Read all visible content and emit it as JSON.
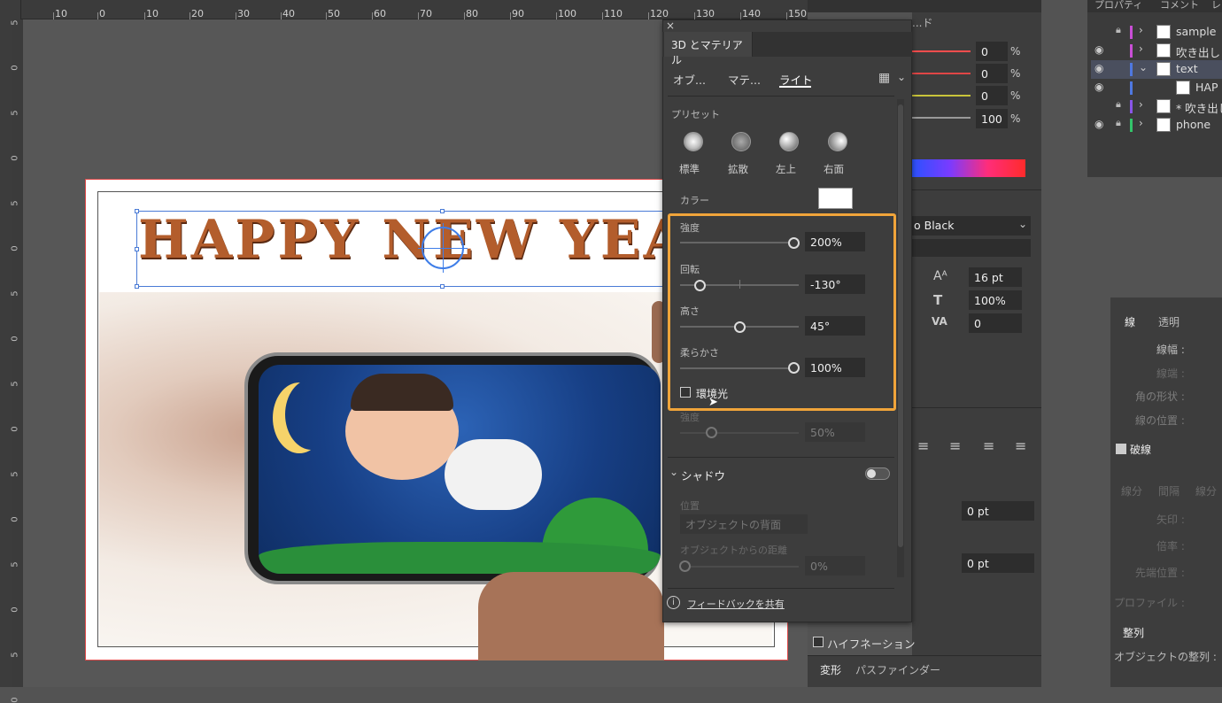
{
  "ruler": {
    "labels": [
      "10",
      "0",
      "10",
      "20",
      "30",
      "40",
      "50",
      "60",
      "70",
      "80",
      "90",
      "100",
      "110",
      "120",
      "130",
      "140",
      "150"
    ]
  },
  "ruler_left": {
    "labels": [
      "5",
      "0",
      "5",
      "0",
      "5",
      "0",
      "5",
      "0",
      "5",
      "0",
      "5",
      "0",
      "5",
      "0",
      "5",
      "0"
    ]
  },
  "artwork": {
    "headline": "HAPPY NEW YEA"
  },
  "panel": {
    "title": "3D とマテリアル",
    "tabs": [
      "オブ...",
      "マテ...",
      "ライト"
    ],
    "active_tab": "ライト",
    "preset_label": "プリセット",
    "presets": [
      "標準",
      "拡散",
      "左上",
      "右面"
    ],
    "color_label": "カラー",
    "color_value": "#ffffff",
    "intensity_label": "強度",
    "intensity_value": "200%",
    "intensity_fraction": 1.0,
    "rotation_label": "回転",
    "rotation_value": "-130°",
    "height_label": "高さ",
    "height_value": "45°",
    "softness_label": "柔らかさ",
    "softness_value": "100%",
    "ambient_label": "環境光",
    "ambient_checked": false,
    "ambient_intensity_label": "強度",
    "ambient_intensity_value": "50%",
    "shadow_label": "シャドウ",
    "position_label": "位置",
    "position_value": "オブジェクトの背面",
    "distance_label": "オブジェクトからの距離",
    "distance_value": "0%",
    "feedback": "フィードバックを共有",
    "highlight_color": "#f0a43a"
  },
  "right_panel": {
    "tab_partial": "...ド",
    "pct1": "0",
    "pct2": "0",
    "pct3": "0",
    "pct4": "100",
    "pct_unit": "%",
    "font_name": "o Black",
    "font_size": "16 pt",
    "scale": "100%",
    "tracking": "0",
    "indent1": "0 pt",
    "indent2": "0 pt",
    "hyphenation": "ハイフネーション",
    "transform_tab": "変形",
    "pathfinder_tab": "パスファインダー"
  },
  "layers_panel": {
    "tabs": [
      "プロパティ",
      "コメント",
      "レ"
    ],
    "rows": [
      {
        "name": "sample",
        "locked": true,
        "visible": false,
        "color": "#c94fd6"
      },
      {
        "name": "吹き出し",
        "locked": false,
        "visible": true,
        "color": "#c94fd6"
      },
      {
        "name": "text",
        "locked": false,
        "visible": true,
        "color": "#4f78e0"
      },
      {
        "name": "HAP",
        "locked": false,
        "visible": true,
        "color": "#4f78e0"
      },
      {
        "name": "* 吹き出し",
        "locked": true,
        "visible": false,
        "color": "#8a56e8"
      },
      {
        "name": "phone",
        "locked": true,
        "visible": true,
        "color": "#33c46a"
      }
    ]
  },
  "stroke_panel": {
    "tabs": [
      "線",
      "透明"
    ],
    "weight": "線幅 :",
    "cap": "線端 :",
    "corner": "角の形状 :",
    "align": "線の位置 :",
    "dashed": "破線",
    "dash_labels": [
      "線分",
      "間隔",
      "線分"
    ],
    "arrow": "矢印 :",
    "scale": "倍率 :",
    "tip": "先端位置 :",
    "profile": "プロファイル :",
    "align_tab": "整列",
    "align_objects": "オブジェクトの整列 :"
  }
}
